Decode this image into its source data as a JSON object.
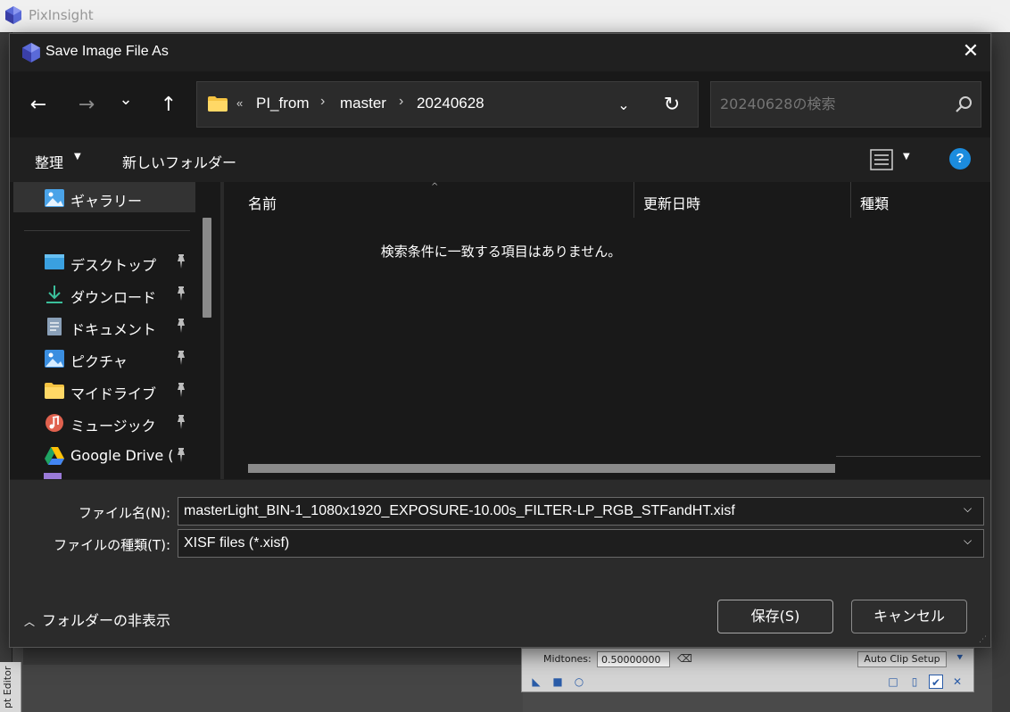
{
  "app": {
    "title": "PixInsight"
  },
  "dialog": {
    "title": "Save Image File As",
    "close_glyph": "✕"
  },
  "nav": {
    "back": "←",
    "forward": "→",
    "recent": "⌄",
    "up": "↑"
  },
  "address": {
    "overflow": "«",
    "segments": [
      "PI_from",
      "master",
      "20240628"
    ],
    "separator": "›"
  },
  "search": {
    "placeholder": "20240628の検索"
  },
  "commands": {
    "organize": "整理",
    "new_folder": "新しいフォルダー",
    "help": "?"
  },
  "sidebar": {
    "items": [
      {
        "label": "ギャラリー",
        "icon": "gallery-icon",
        "pinned": false
      },
      {
        "label": "デスクトップ",
        "icon": "desktop-icon",
        "pinned": true
      },
      {
        "label": "ダウンロード",
        "icon": "download-icon",
        "pinned": true
      },
      {
        "label": "ドキュメント",
        "icon": "document-icon",
        "pinned": true
      },
      {
        "label": "ピクチャ",
        "icon": "pictures-icon",
        "pinned": true
      },
      {
        "label": "マイドライブ",
        "icon": "folder-icon",
        "pinned": true
      },
      {
        "label": "ミュージック",
        "icon": "music-icon",
        "pinned": true
      },
      {
        "label": "Google Drive (",
        "icon": "google-drive-icon",
        "pinned": true
      }
    ]
  },
  "file_list": {
    "columns": [
      "名前",
      "更新日時",
      "種類"
    ],
    "empty_message": "検索条件に一致する項目はありません。"
  },
  "form": {
    "filename_label": "ファイル名(N):",
    "filename_value": "masterLight_BIN-1_1080x1920_EXPOSURE-10.00s_FILTER-LP_RGB_STFandHT.xisf",
    "filetype_label": "ファイルの種類(T):",
    "filetype_value": "XISF files (*.xisf)",
    "hide_folders": "フォルダーの非表示",
    "save": "保存(S)",
    "cancel": "キャンセル"
  },
  "stf_panel": {
    "midtones_label": "Midtones:",
    "midtones_value": "0.50000000",
    "auto_clip": "Auto Clip Setup"
  },
  "side_tab": {
    "label": "pt Editor"
  },
  "colors": {
    "dialog_bg": "#202020",
    "pane_bg": "#191919",
    "footer_bg": "#2b2b2b",
    "accent_blue": "#1b8cde"
  }
}
